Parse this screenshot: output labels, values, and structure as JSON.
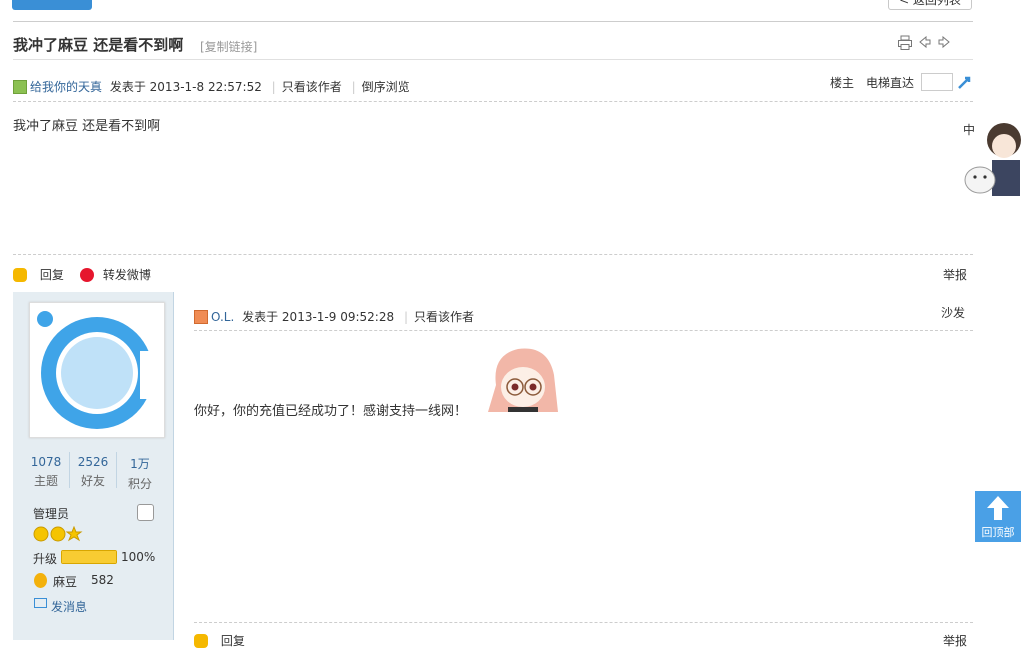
{
  "top": {
    "back_label": "< 返回列表"
  },
  "thread": {
    "title": "我冲了麻豆 还是看不到啊",
    "copy_link": "[复制链接]"
  },
  "post1": {
    "author": "给我你的天真",
    "posted": "发表于 2013-1-8 22:57:52",
    "only_author": "只看该作者",
    "reverse": "倒序浏览",
    "floor": "楼主",
    "elevator": "电梯直达",
    "body": "我冲了麻豆 还是看不到啊",
    "reply": "回复",
    "weibo": "转发微博",
    "report": "举报"
  },
  "user": {
    "stats": [
      {
        "num": "1078",
        "label": "主题"
      },
      {
        "num": "2526",
        "label": "好友"
      },
      {
        "num": "1万",
        "label": "积分"
      }
    ],
    "group": "管理员",
    "level_label": "升级",
    "level_pct_text": "100%",
    "level_pct": 100,
    "coin_label": "麻豆",
    "coin_value": "582",
    "message": "发消息"
  },
  "post2": {
    "author": "O.L.",
    "posted": "发表于 2013-1-9 09:52:28",
    "only_author": "只看该作者",
    "floor": "沙发",
    "body": "你好，你的充值已经成功了！感谢支持一线网！",
    "reply": "回复",
    "report": "举报"
  },
  "gotop": {
    "label": "回顶部"
  },
  "colors": {
    "accent": "#3a8fd6",
    "link": "#336699",
    "sidebar_bg": "#e5edf2"
  }
}
